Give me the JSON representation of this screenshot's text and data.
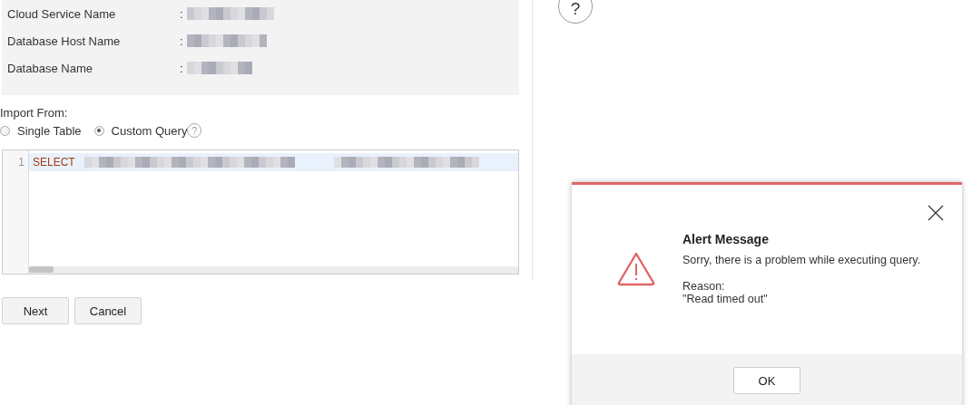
{
  "connection_details": [
    {
      "label": "Cloud Service Name",
      "separator": ":"
    },
    {
      "label": "Database Host Name",
      "separator": ":"
    },
    {
      "label": "Database Name",
      "separator": ":"
    }
  ],
  "import_from": {
    "label": "Import From:",
    "options": [
      {
        "label": "Single Table",
        "selected": false
      },
      {
        "label": "Custom Query",
        "selected": true,
        "help": "?"
      }
    ]
  },
  "query_editor": {
    "lines": [
      {
        "number": "1",
        "keyword": "SELECT",
        "highlighted": true
      }
    ]
  },
  "buttons": [
    {
      "label": "Next"
    },
    {
      "label": "Cancel"
    }
  ],
  "help_button": {
    "glyph": "?"
  },
  "alert_dialog": {
    "title": "Alert Message",
    "message": "Sorry, there is a problem while executing query.",
    "reason_label": "Reason:",
    "reason": "\"Read timed out\"",
    "buttons": [
      {
        "label": "OK"
      }
    ]
  }
}
